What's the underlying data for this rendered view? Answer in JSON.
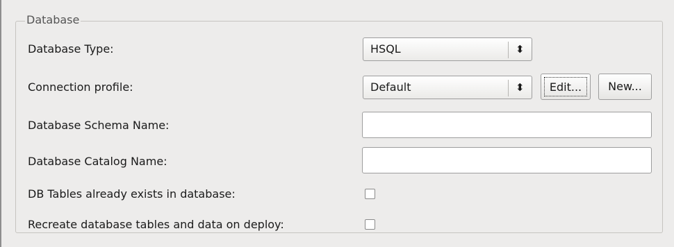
{
  "group": {
    "title": "Database"
  },
  "rows": {
    "database_type": {
      "label": "Database Type:",
      "value": "HSQL",
      "arrows_icon": "up-down-arrows-icon"
    },
    "connection_profile": {
      "label": "Connection profile:",
      "value": "Default",
      "arrows_icon": "up-down-arrows-icon",
      "edit_label": "Edit...",
      "new_label": "New..."
    },
    "schema_name": {
      "label": "Database Schema Name:",
      "value": ""
    },
    "catalog_name": {
      "label": "Database Catalog Name:",
      "value": ""
    },
    "tables_exist": {
      "label": "DB Tables already exists in database:",
      "checked": false
    },
    "recreate_tables": {
      "label": "Recreate database tables and data on deploy:",
      "checked": false
    }
  }
}
